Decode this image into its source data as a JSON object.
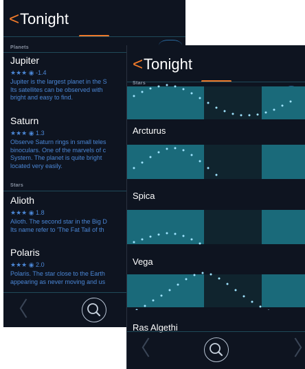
{
  "back_screen": {
    "nav": {
      "back_glyph": "<",
      "title": "Tonight"
    },
    "sections": [
      {
        "header": "Planets",
        "items": [
          {
            "name": "Jupiter",
            "rating": "★★★ ◉ -1.4",
            "desc": [
              "Jupiter is the largest planet in the S",
              "Its satellites can be observed with",
              "bright and easy to find."
            ]
          },
          {
            "name": "Saturn",
            "rating": "★★★ ◉ 1.3",
            "desc": [
              "Observe Saturn rings in small teles",
              "binoculars. One of the marvels of c",
              "System. The planet is quite bright",
              "located very easily."
            ]
          }
        ]
      },
      {
        "header": "Stars",
        "items": [
          {
            "name": "Alioth",
            "rating": "★★★ ◉ 1.8",
            "desc": [
              "Alioth. The second star in the Big D",
              "Its name refer to 'The Fat Tail of th"
            ]
          },
          {
            "name": "Polaris",
            "rating": "★★★ ◉ 2.0",
            "desc": [
              "Polaris. The star close to the Earth",
              "appearing as never moving and us"
            ]
          }
        ]
      }
    ]
  },
  "front_screen": {
    "nav": {
      "back_glyph": "<",
      "title": "Tonight"
    },
    "section_header": "Stars",
    "stars": [
      "Arcturus",
      "Spica",
      "Vega",
      "Ras Algethi"
    ]
  },
  "icons": {
    "back": "chevron-left-icon",
    "search": "search-icon",
    "next": "chevron-right-icon"
  },
  "colors": {
    "accent": "#f07a2a",
    "background": "#0e1420",
    "link": "#4b87d6",
    "chart_band": "#1a6a7a"
  }
}
